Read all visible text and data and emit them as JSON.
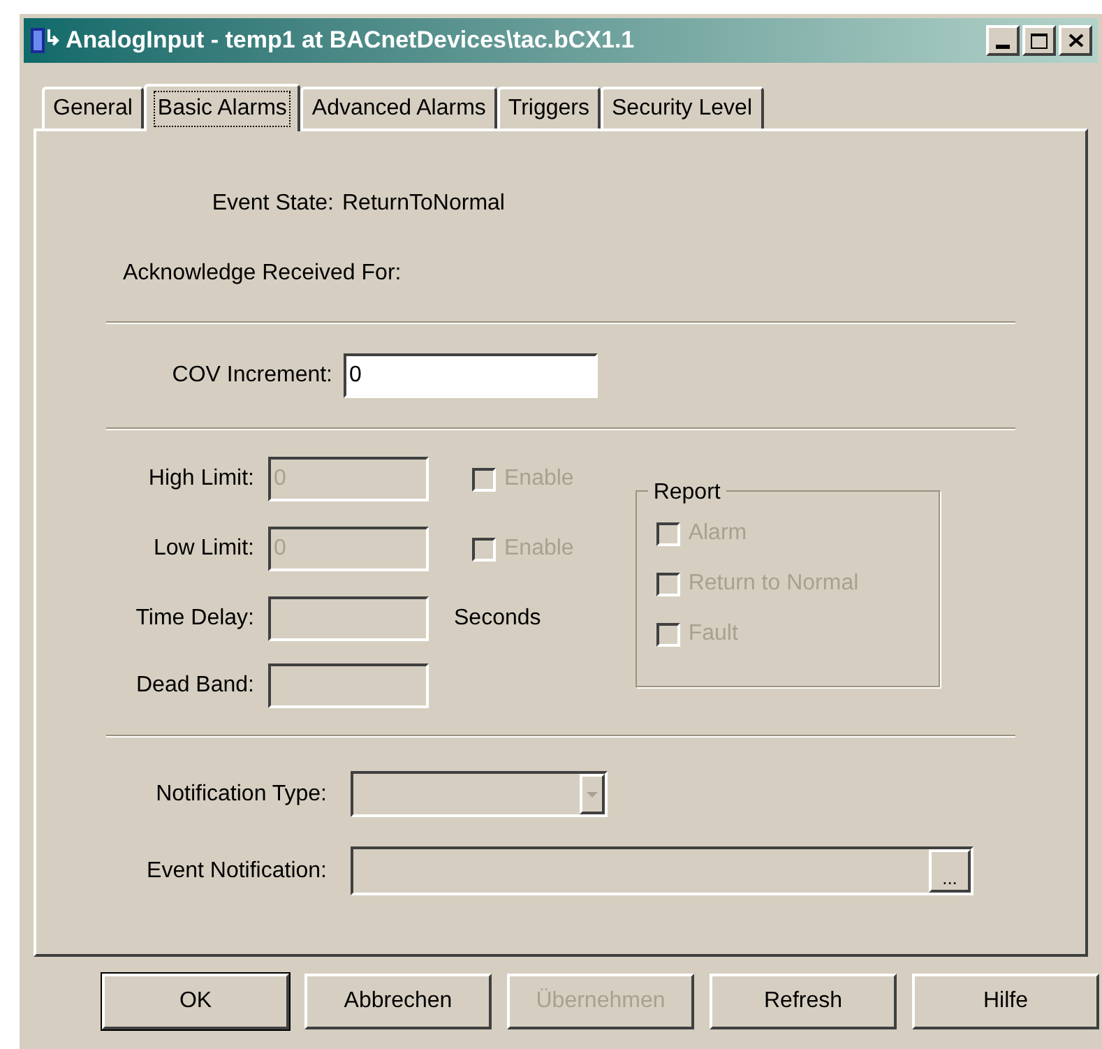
{
  "window": {
    "title": "AnalogInput - temp1 at BACnetDevices\\tac.bCX1.1"
  },
  "tabs": [
    {
      "label": "General",
      "selected": false
    },
    {
      "label": "Basic Alarms",
      "selected": true
    },
    {
      "label": "Advanced Alarms",
      "selected": false
    },
    {
      "label": "Triggers",
      "selected": false
    },
    {
      "label": "Security Level",
      "selected": false
    }
  ],
  "event_state": {
    "label": "Event State:",
    "value": "ReturnToNormal"
  },
  "acknowledge": {
    "label": "Acknowledge Received For:"
  },
  "cov_increment": {
    "label": "COV Increment:",
    "value": "0",
    "disabled": false
  },
  "limits": [
    {
      "label": "High Limit:",
      "value": "0",
      "disabled": true,
      "enable": {
        "label": "Enable",
        "checked": false,
        "disabled": true
      }
    },
    {
      "label": "Low Limit:",
      "value": "0",
      "disabled": true,
      "enable": {
        "label": "Enable",
        "checked": false,
        "disabled": true
      }
    }
  ],
  "time_delay": {
    "label": "Time Delay:",
    "unit": "Seconds",
    "disabled": true
  },
  "dead_band": {
    "label": "Dead Band:",
    "disabled": true
  },
  "report": {
    "title": "Report",
    "options": [
      {
        "label": "Alarm",
        "checked": false,
        "disabled": true
      },
      {
        "label": "Return to Normal",
        "checked": false,
        "disabled": true
      },
      {
        "label": "Fault",
        "checked": false,
        "disabled": true
      }
    ]
  },
  "notification_type": {
    "label": "Notification Type:",
    "disabled": true
  },
  "event_notification": {
    "label": "Event Notification:",
    "button": "...",
    "disabled": true
  },
  "buttons": [
    {
      "label": "OK",
      "default": true,
      "disabled": false
    },
    {
      "label": "Abbrechen",
      "default": false,
      "disabled": false
    },
    {
      "label": "Übernehmen",
      "default": false,
      "disabled": true
    },
    {
      "label": "Refresh",
      "default": false,
      "disabled": false
    },
    {
      "label": "Hilfe",
      "default": false,
      "disabled": false
    }
  ]
}
